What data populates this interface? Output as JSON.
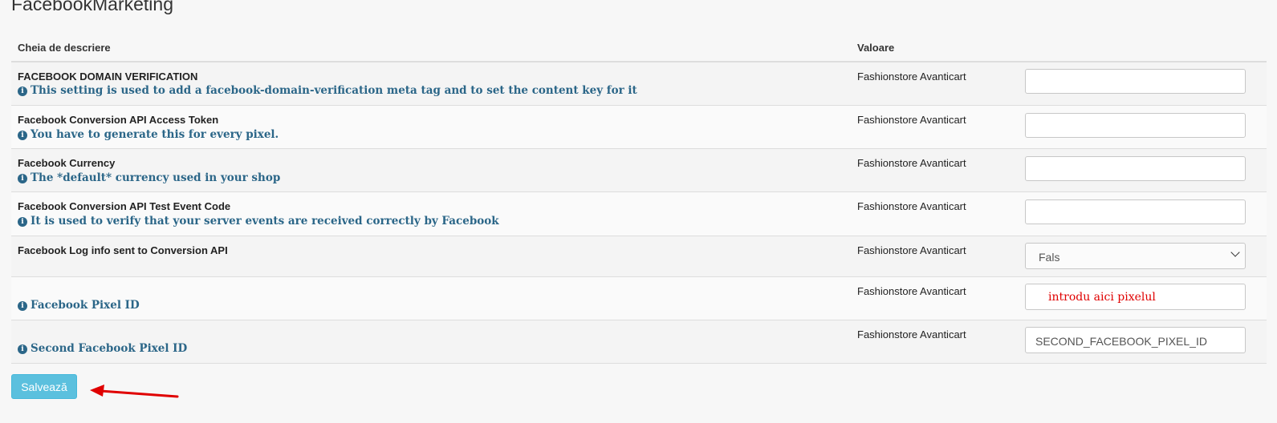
{
  "page": {
    "title": "FacebookMarketing"
  },
  "table": {
    "headers": {
      "key": "Cheia de descriere",
      "value": "Valoare"
    },
    "rows": [
      {
        "title": "FACEBOOK DOMAIN VERIFICATION",
        "description": "This setting is used to add a facebook-domain-verification meta tag and to set the content key for it",
        "store": "Fashionstore Avanticart",
        "field_type": "text",
        "value": ""
      },
      {
        "title": "Facebook Conversion API Access Token",
        "description": "You have to generate this for every pixel.",
        "store": "Fashionstore Avanticart",
        "field_type": "text",
        "value": ""
      },
      {
        "title": "Facebook Currency",
        "description": "The *default* currency used in your shop",
        "store": "Fashionstore Avanticart",
        "field_type": "text",
        "value": ""
      },
      {
        "title": "Facebook Conversion API Test Event Code",
        "description": "It is used to verify that your server events are received correctly by Facebook",
        "store": "Fashionstore Avanticart",
        "field_type": "text",
        "value": ""
      },
      {
        "title": "Facebook Log info sent to Conversion API",
        "description": "",
        "store": "Fashionstore Avanticart",
        "field_type": "select",
        "value": "Fals"
      },
      {
        "title": "",
        "description": "Facebook Pixel ID",
        "store": "Fashionstore Avanticart",
        "field_type": "text",
        "value": "introdu aici pixelul"
      },
      {
        "title": "",
        "description": "Second Facebook Pixel ID",
        "store": "Fashionstore Avanticart",
        "field_type": "text",
        "value": "SECOND_FACEBOOK_PIXEL_ID"
      }
    ]
  },
  "actions": {
    "save_label": "Salvează"
  },
  "icons": {
    "info": "info-circle-icon",
    "select_caret": "chevron-down-icon",
    "annotation": "red-arrow-annotation"
  },
  "colors": {
    "description_text": "#2b6688",
    "save_button": "#5bc0de",
    "annotation_arrow": "#e00000",
    "pixel_value_text": "#e00000"
  }
}
